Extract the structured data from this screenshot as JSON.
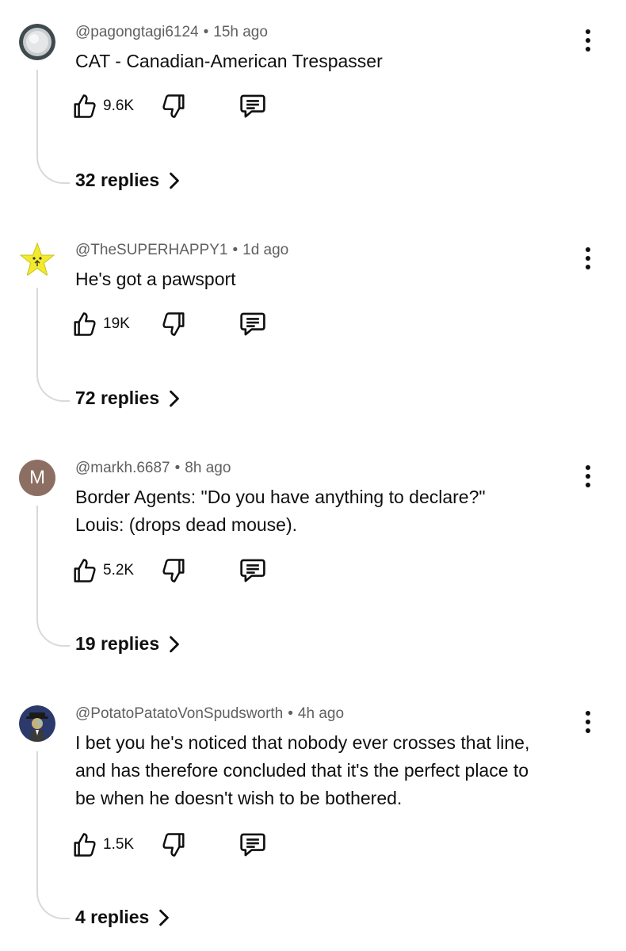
{
  "comments": [
    {
      "handle": "@pagongtagi6124",
      "time": "15h ago",
      "lines": [
        "CAT - Canadian-American Trespasser"
      ],
      "likes": "9.6K",
      "replies_label": "32 replies",
      "avatar": "coin-avatar"
    },
    {
      "handle": "@TheSUPERHAPPY1",
      "time": "1d ago",
      "lines": [
        "He's got a pawsport"
      ],
      "likes": "19K",
      "replies_label": "72 replies",
      "avatar": "star-avatar"
    },
    {
      "handle": "@markh.6687",
      "time": "8h ago",
      "lines": [
        "Border Agents: \"Do you have anything to declare?\"",
        "Louis: (drops dead mouse)."
      ],
      "likes": "5.2K",
      "replies_label": "19 replies",
      "avatar_letter": "M"
    },
    {
      "handle": "@PotatoPatatoVonSpudsworth",
      "time": "4h ago",
      "lines": [
        "I bet you he's noticed that nobody ever crosses that line,",
        "and has therefore concluded that it's the perfect place to",
        "be when he doesn't wish to be bothered."
      ],
      "likes": "1.5K",
      "replies_label": "4 replies",
      "avatar": "spy-avatar"
    }
  ],
  "separator": "•",
  "icons": {
    "like": "thumbs-up-icon",
    "dislike": "thumbs-down-icon",
    "reply": "comment-icon",
    "more": "more-vert-icon",
    "chevron": "chevron-right-icon"
  },
  "colors": {
    "text": "#0f0f0f",
    "secondary": "#606060",
    "thread_line": "#d9d9d9",
    "avatar_m": "#8d6e63"
  }
}
